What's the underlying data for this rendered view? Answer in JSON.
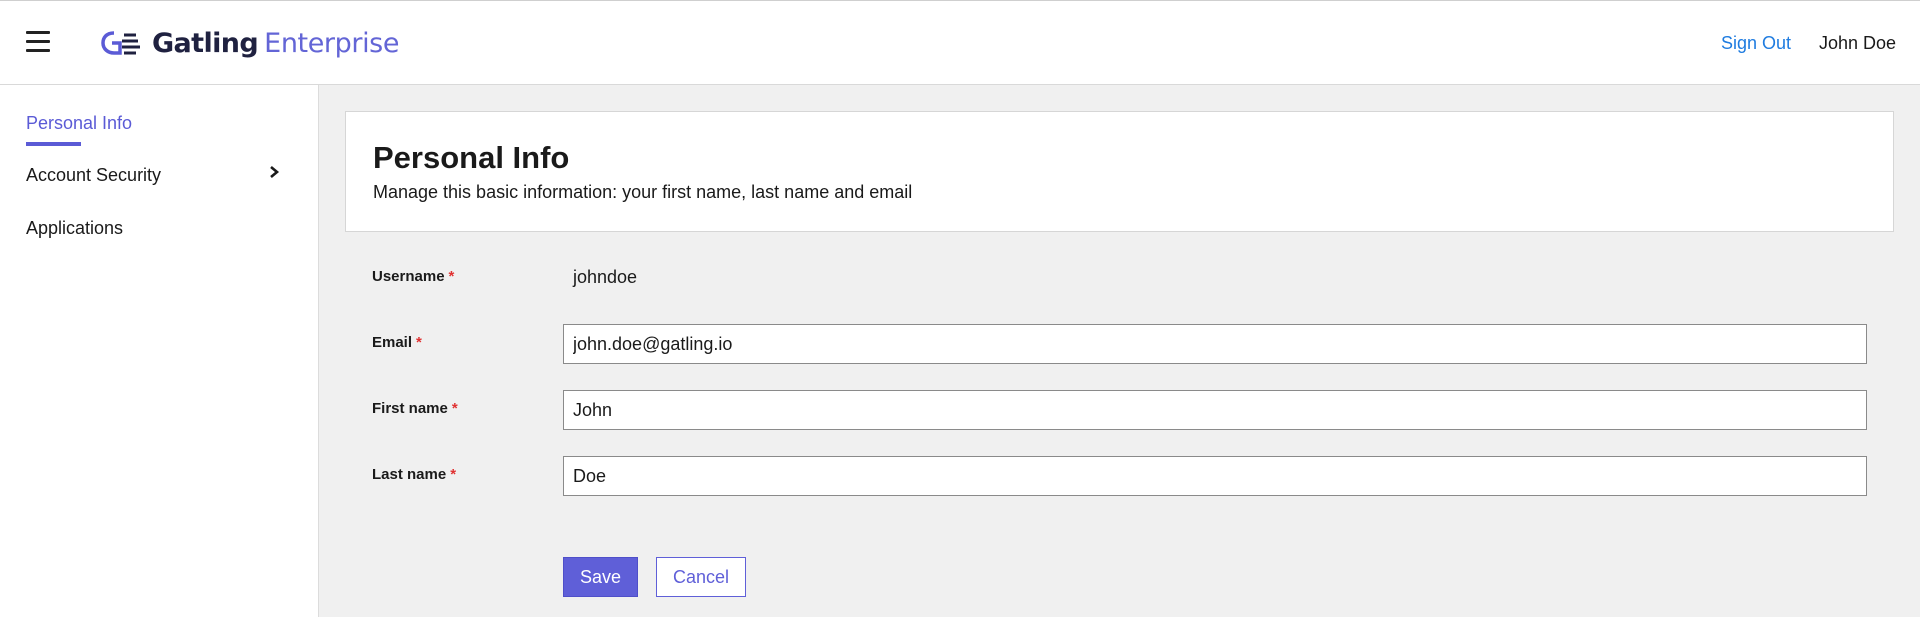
{
  "header": {
    "logo_primary": "Gatling",
    "logo_secondary": "Enterprise",
    "sign_out_label": "Sign Out",
    "user_name": "John Doe"
  },
  "sidebar": {
    "items": [
      {
        "label": "Personal Info",
        "active": true
      },
      {
        "label": "Account Security",
        "active": false
      },
      {
        "label": "Applications",
        "active": false
      }
    ]
  },
  "card": {
    "title": "Personal Info",
    "subtitle": "Manage this basic information: your first name, last name and email"
  },
  "form": {
    "required_marker": "*",
    "username": {
      "label": "Username",
      "value": "johndoe"
    },
    "email": {
      "label": "Email",
      "value": "john.doe@gatling.io"
    },
    "first_name": {
      "label": "First name",
      "value": "John"
    },
    "last_name": {
      "label": "Last name",
      "value": "Doe"
    }
  },
  "actions": {
    "save_label": "Save",
    "cancel_label": "Cancel"
  },
  "colors": {
    "accent": "#5f5fd8",
    "link": "#1f7ce0",
    "required": "#e03131"
  }
}
